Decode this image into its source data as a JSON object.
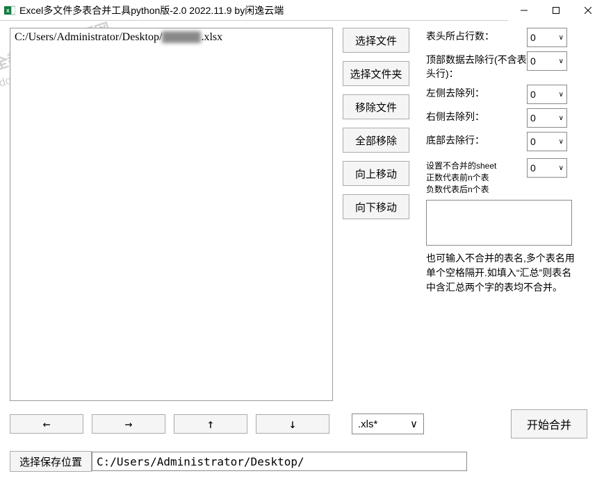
{
  "titlebar": {
    "title": "Excel多文件多表合并工具python版-2.0 2022.11.9 by闲逸云端"
  },
  "watermark": {
    "line1": "全都有综合资源网",
    "line2": "douyouvip.com"
  },
  "file_list": {
    "entries": [
      {
        "prefix": "C:/Users/Administrator/Desktop/",
        "blurred": "xxxxxxx",
        "suffix": ".xlsx"
      }
    ]
  },
  "buttons": {
    "select_file": "选择文件",
    "select_folder": "选择文件夹",
    "remove_file": "移除文件",
    "remove_all": "全部移除",
    "move_up": "向上移动",
    "move_down": "向下移动"
  },
  "settings": {
    "header_rows": {
      "label": "表头所占行数：",
      "value": "0"
    },
    "top_drop": {
      "label": "顶部数据去除行(不含表头行)：",
      "value": "0"
    },
    "left_drop": {
      "label": "左侧去除列：",
      "value": "0"
    },
    "right_drop": {
      "label": "右侧去除列：",
      "value": "0"
    },
    "bottom_drop": {
      "label": "底部去除行：",
      "value": "0"
    },
    "sheet_exclude": {
      "label": "设置不合并的sheet\n正数代表前n个表\n负数代表后n个表",
      "value": "0"
    },
    "exclude_names_desc": "也可输入不合并的表名,多个表名用单个空格隔开.如填入“汇总”则表名中含汇总两个字的表均不合并。"
  },
  "bottom": {
    "arrow_left": "←",
    "arrow_right": "→",
    "arrow_up": "↑",
    "arrow_down": "↓",
    "ext_value": ".xls*",
    "start": "开始合并"
  },
  "save": {
    "button": "选择保存位置",
    "path": "C:/Users/Administrator/Desktop/"
  }
}
